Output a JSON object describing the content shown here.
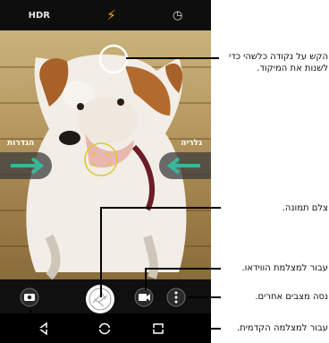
{
  "topbar": {
    "hdr_label": "HDR",
    "flash_icon": "flash-auto-icon",
    "timer_icon": "timer-icon"
  },
  "viewfinder": {
    "left_label": "הגדרות",
    "right_label": "גלריה"
  },
  "controls": {
    "front_camera_icon": "switch-camera-icon",
    "shutter_icon": "shutter-icon",
    "video_icon": "video-camera-icon",
    "more_icon": "more-modes-icon"
  },
  "nav": {
    "back_icon": "back-icon",
    "home_icon": "home-icon",
    "recents_icon": "recents-icon"
  },
  "annotations": {
    "focus": "הקש על נקודה כלשהי כדי לשנות את המיקוד.",
    "take_photo": "צלם תמונה.",
    "video": "עבור למצלמת הווידאו.",
    "more_modes": "נסה מצבים אחרים.",
    "front_camera": "עבור למצלמה הקדמית."
  }
}
